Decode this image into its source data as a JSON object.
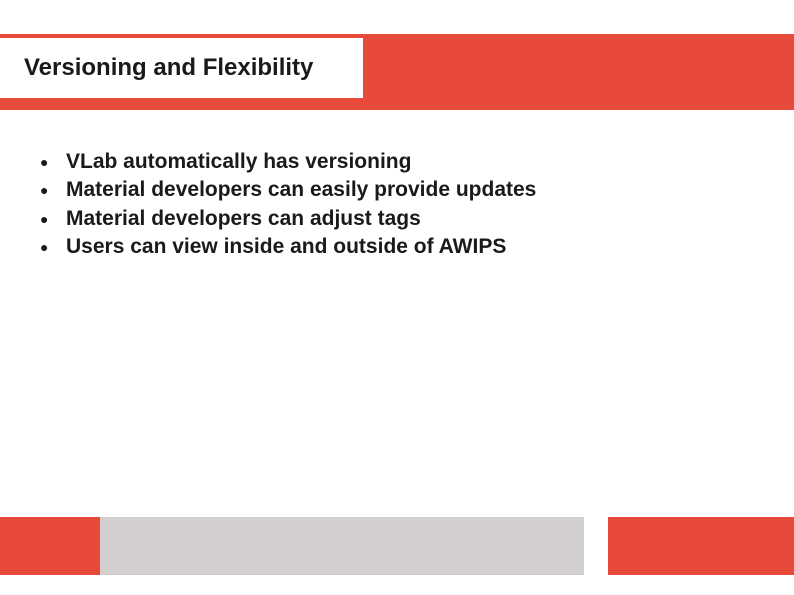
{
  "slide": {
    "title": "Versioning and Flexibility",
    "bullets": [
      "VLab automatically has versioning",
      "Material developers can easily provide updates",
      "Material developers can adjust tags",
      "Users can view inside and outside of AWIPS"
    ]
  },
  "theme": {
    "accent": "#e74a3b",
    "muted": "#d4cfcf"
  }
}
